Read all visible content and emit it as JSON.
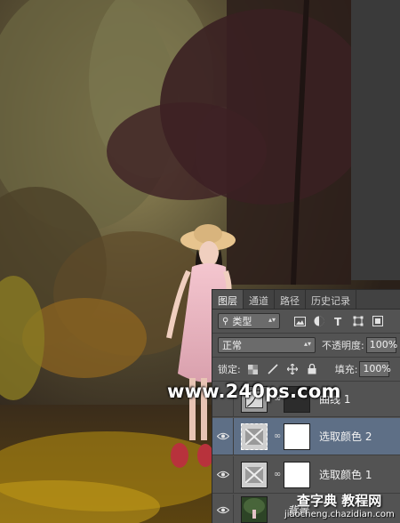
{
  "panel": {
    "tabs": [
      {
        "label": "图层",
        "active": true
      },
      {
        "label": "通道",
        "active": false
      },
      {
        "label": "路径",
        "active": false
      },
      {
        "label": "历史记录",
        "active": false
      }
    ],
    "filter": {
      "search_icon": "search-icon",
      "value": "类型",
      "icons": [
        "image-filter-icon",
        "adjustment-filter-icon",
        "text-filter-icon",
        "shape-filter-icon",
        "smart-object-filter-icon"
      ]
    },
    "blend": {
      "mode": "正常",
      "opacity_label": "不透明度:",
      "opacity": "100%"
    },
    "lock": {
      "label": "锁定:",
      "icons": [
        "lock-transparency-icon",
        "lock-paint-icon",
        "lock-move-icon",
        "lock-all-icon"
      ],
      "fill_label": "填充:",
      "fill": "100%"
    },
    "layers": [
      {
        "name": "曲线 1",
        "visible": false,
        "selected": false,
        "thumb": "curves-adjustment-icon"
      },
      {
        "name": "选取颜色 2",
        "visible": true,
        "selected": true,
        "thumb": "selective-color-icon"
      },
      {
        "name": "选取颜色 1",
        "visible": true,
        "selected": false,
        "thumb": "selective-color-icon"
      },
      {
        "name": "背景",
        "visible": true,
        "selected": false,
        "thumb": "photo-thumbnail"
      }
    ],
    "colors": {
      "selected": "#5e6f86",
      "panel": "#535353",
      "tabbar": "#424242"
    }
  },
  "watermark": "www.240ps.com",
  "site_badge": {
    "line1": "查字典 教程网",
    "line2": "jiaocheng.chazidian.com"
  }
}
